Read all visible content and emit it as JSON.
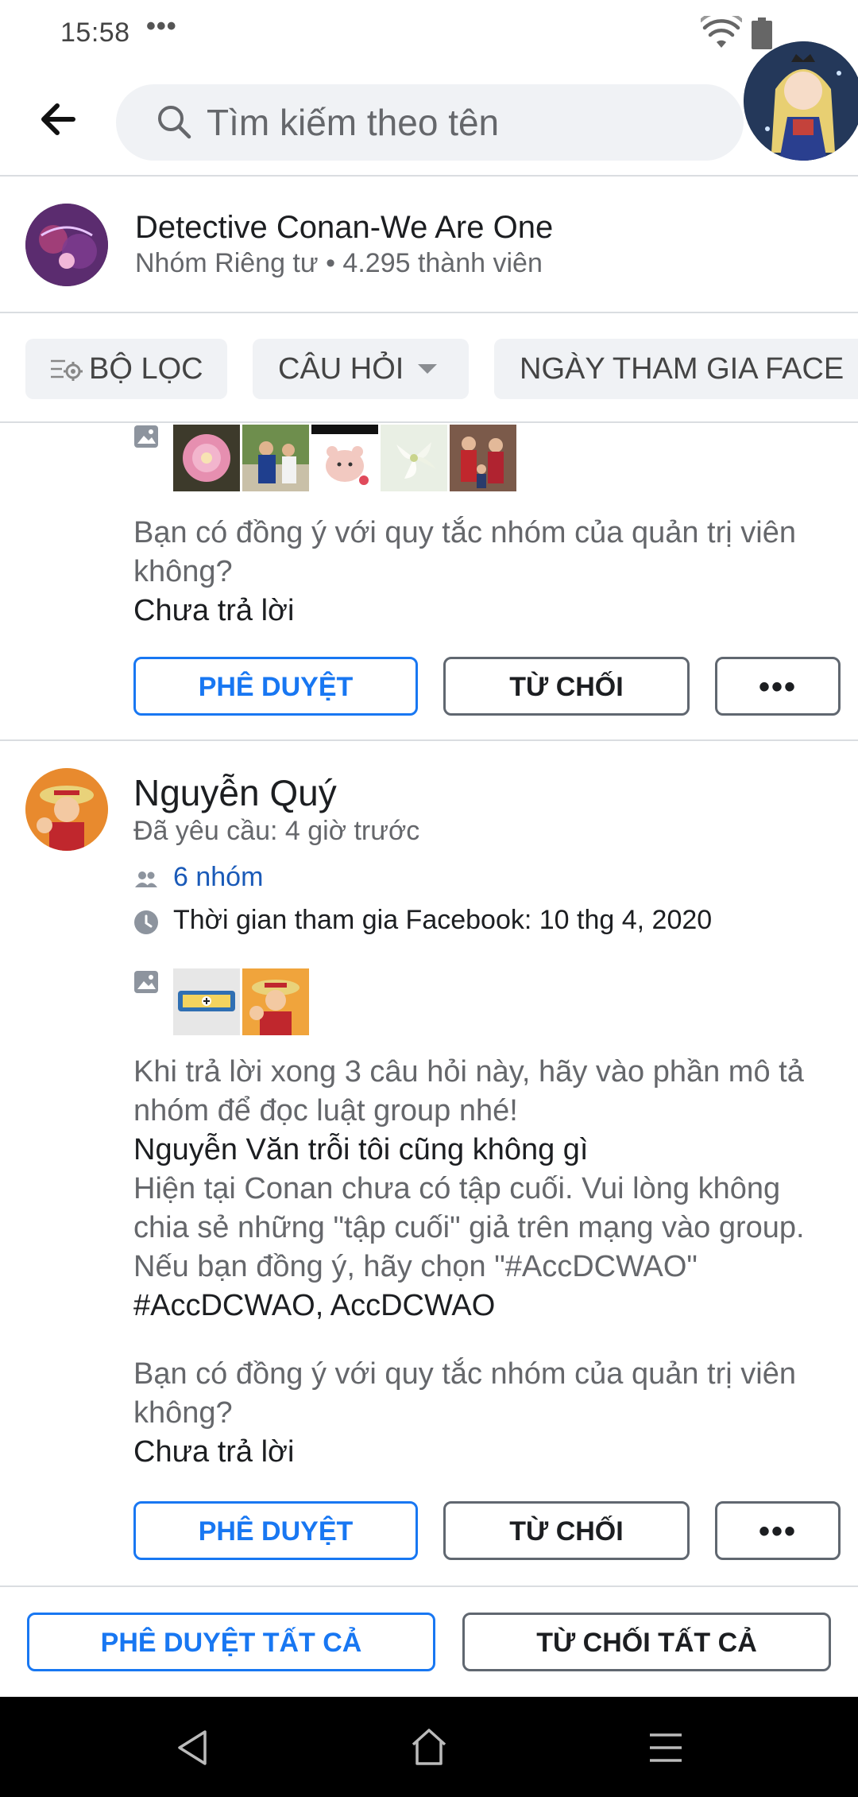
{
  "status_bar": {
    "time": "15:58",
    "dots": "•••"
  },
  "search": {
    "placeholder": "Tìm kiếm theo tên"
  },
  "group": {
    "name": "Detective Conan-We Are One",
    "meta": "Nhóm Riêng tư • 4.295 thành viên"
  },
  "filters": {
    "filter_label": "BỘ LỌC",
    "questions_label": "CÂU HỎI",
    "joined_label": "NGÀY THAM GIA FACE"
  },
  "request1": {
    "question": "Bạn có đồng ý với quy tắc nhóm của quản trị viên không?",
    "answer": "Chưa trả lời",
    "approve": "PHÊ DUYỆT",
    "decline": "TỪ CHỐI",
    "more": "•••"
  },
  "request2": {
    "name": "Nguyễn Quý",
    "requested": "Đã yêu cầu: 4 giờ trước",
    "groups": "6 nhóm",
    "joined_facebook": "Thời gian tham gia Facebook: 10 thg 4, 2020",
    "q1": "Khi trả lời xong 3 câu hỏi này, hãy vào phần mô tả nhóm để đọc luật group nhé!",
    "a1": "Nguyễn Văn trỗi tôi cũng không gì",
    "q2": "Hiện tại Conan chưa có tập cuối. Vui lòng không chia sẻ những \"tập cuối\" giả trên mạng vào group. Nếu bạn đồng ý, hãy chọn \"#AccDCWAO\"",
    "a2": "#AccDCWAO, AccDCWAO",
    "q3": "Bạn có đồng ý với quy tắc nhóm của quản trị viên không?",
    "a3": "Chưa trả lời",
    "approve": "PHÊ DUYỆT",
    "decline": "TỪ CHỐI",
    "more": "•••"
  },
  "bottom": {
    "approve_all": "PHÊ DUYỆT TẤT CẢ",
    "decline_all": "TỪ CHỐI TẤT CẢ"
  },
  "icons": {
    "back": "arrow-left-icon",
    "search": "search-icon",
    "filter": "filter-settings-icon",
    "caret": "caret-down-icon",
    "photo": "photo-icon",
    "groups": "people-icon",
    "clock": "clock-icon"
  },
  "colors": {
    "accent": "#1877f2",
    "link": "#1a5ab8",
    "secondary_text": "#65676b",
    "divider": "#dadde1"
  }
}
